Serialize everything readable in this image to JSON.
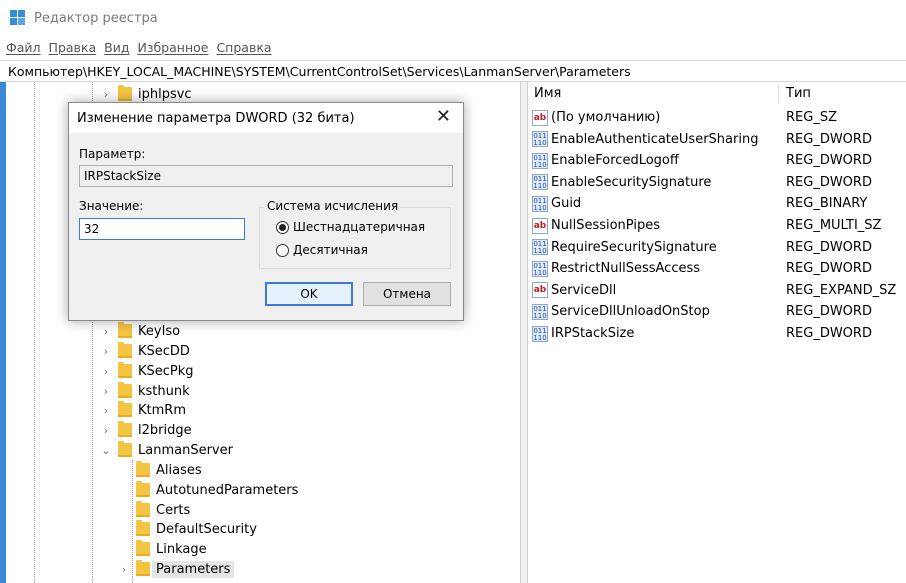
{
  "window": {
    "title": "Редактор реестра"
  },
  "menu": [
    "Файл",
    "Правка",
    "Вид",
    "Избранное",
    "Справка"
  ],
  "address": "Компьютер\\HKEY_LOCAL_MACHINE\\SYSTEM\\CurrentControlSet\\Services\\LanmanServer\\Parameters",
  "tree": {
    "top_item": "iphlpsvc",
    "items": [
      "KeyIso",
      "KSecDD",
      "KSecPkg",
      "ksthunk",
      "KtmRm",
      "l2bridge",
      "LanmanServer"
    ],
    "children": [
      "Aliases",
      "AutotunedParameters",
      "Certs",
      "DefaultSecurity",
      "Linkage",
      "Parameters"
    ],
    "selected": "Parameters"
  },
  "list": {
    "col_name": "Имя",
    "col_type": "Тип",
    "values": [
      {
        "name": "(По умолчанию)",
        "type": "REG_SZ",
        "icon": "string-value-icon"
      },
      {
        "name": "EnableAuthenticateUserSharing",
        "type": "REG_DWORD",
        "icon": "binary-value-icon"
      },
      {
        "name": "EnableForcedLogoff",
        "type": "REG_DWORD",
        "icon": "binary-value-icon"
      },
      {
        "name": "EnableSecuritySignature",
        "type": "REG_DWORD",
        "icon": "binary-value-icon"
      },
      {
        "name": "Guid",
        "type": "REG_BINARY",
        "icon": "binary-value-icon"
      },
      {
        "name": "NullSessionPipes",
        "type": "REG_MULTI_SZ",
        "icon": "string-value-icon"
      },
      {
        "name": "RequireSecuritySignature",
        "type": "REG_DWORD",
        "icon": "binary-value-icon"
      },
      {
        "name": "RestrictNullSessAccess",
        "type": "REG_DWORD",
        "icon": "binary-value-icon"
      },
      {
        "name": "ServiceDll",
        "type": "REG_EXPAND_SZ",
        "icon": "string-value-icon"
      },
      {
        "name": "ServiceDllUnloadOnStop",
        "type": "REG_DWORD",
        "icon": "binary-value-icon"
      },
      {
        "name": "IRPStackSize",
        "type": "REG_DWORD",
        "icon": "binary-value-icon"
      }
    ]
  },
  "dialog": {
    "title": "Изменение параметра DWORD (32 бита)",
    "param_label": "Параметр:",
    "param_value": "IRPStackSize",
    "value_label": "Значение:",
    "value_input": "32",
    "base_label": "Система исчисления",
    "radio_hex": "Шестнадцатеричная",
    "radio_dec": "Десятичная",
    "ok": "OK",
    "cancel": "Отмена"
  },
  "colors": {
    "accent": "#3a7bd5",
    "folder": "#f4c542",
    "left_edge": "#3a88d6"
  }
}
